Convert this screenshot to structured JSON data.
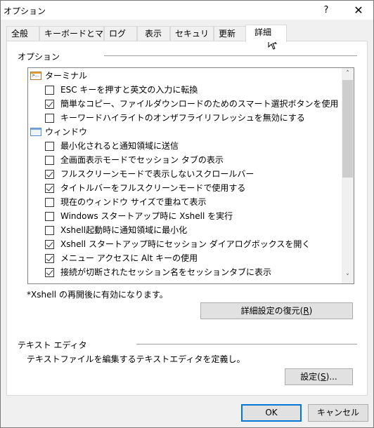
{
  "window": {
    "title": "オプション",
    "help_label": "?",
    "close_label": "✕"
  },
  "tabs": [
    {
      "label": "全般",
      "active": false
    },
    {
      "label": "キーボードとマウス",
      "active": false
    },
    {
      "label": "ログ",
      "active": false
    },
    {
      "label": "表示",
      "active": false
    },
    {
      "label": "セキュリティ",
      "active": false
    },
    {
      "label": "更新",
      "active": false
    },
    {
      "label": "詳細",
      "active": true
    }
  ],
  "options_group": {
    "label": "オプション",
    "categories": [
      {
        "label": "ターミナル",
        "icon": "terminal-icon",
        "items": [
          {
            "label": "ESC キーを押すと英文の入力に転換",
            "checked": false
          },
          {
            "label": "簡単なコピー、ファイルダウンロードのためのスマート選択ボタンを使用",
            "checked": true
          },
          {
            "label": "キーワードハイライトのオンザフライリフレッシュを無効にする",
            "checked": false
          }
        ]
      },
      {
        "label": "ウィンドウ",
        "icon": "window-icon",
        "items": [
          {
            "label": "最小化されると通知領域に送信",
            "checked": false
          },
          {
            "label": "全画面表示モードでセッション タブの表示",
            "checked": false
          },
          {
            "label": "フルスクリーンモードで表示しないスクロールバー",
            "checked": true
          },
          {
            "label": "タイトルバーをフルスクリーンモードで使用する",
            "checked": true
          },
          {
            "label": "現在のウィンドウ サイズで重ねて表示",
            "checked": false
          },
          {
            "label": "Windows スタートアップ時に Xshell を実行",
            "checked": false
          },
          {
            "label": "Xshell起動時に通知領域に最小化",
            "checked": false
          },
          {
            "label": "Xshell スタートアップ時にセッション ダイアログボックスを開く",
            "checked": true
          },
          {
            "label": "メニュー アクセスに Alt キーの使用",
            "checked": true
          },
          {
            "label": "接続が切断されたセッション名をセッションタブに表示",
            "checked": true
          }
        ]
      }
    ],
    "scroll": {
      "thumb_start": 0.0,
      "thumb_fraction": 0.51
    },
    "note": "*Xshell の再開後に有効になります。",
    "restore_button": {
      "label": "詳細設定の復元(",
      "mnemonic": "R",
      "suffix": ")"
    }
  },
  "text_editor_group": {
    "label": "テキスト エディタ",
    "description": "テキストファイルを編集するテキストエディタを定義し。",
    "settings_button": {
      "label": "設定(",
      "mnemonic": "S",
      "suffix": ")..."
    }
  },
  "footer": {
    "ok_label": "OK",
    "cancel_label": "キャンセル"
  },
  "scrollbar_icons": {
    "up": "˄",
    "down": "˅"
  }
}
